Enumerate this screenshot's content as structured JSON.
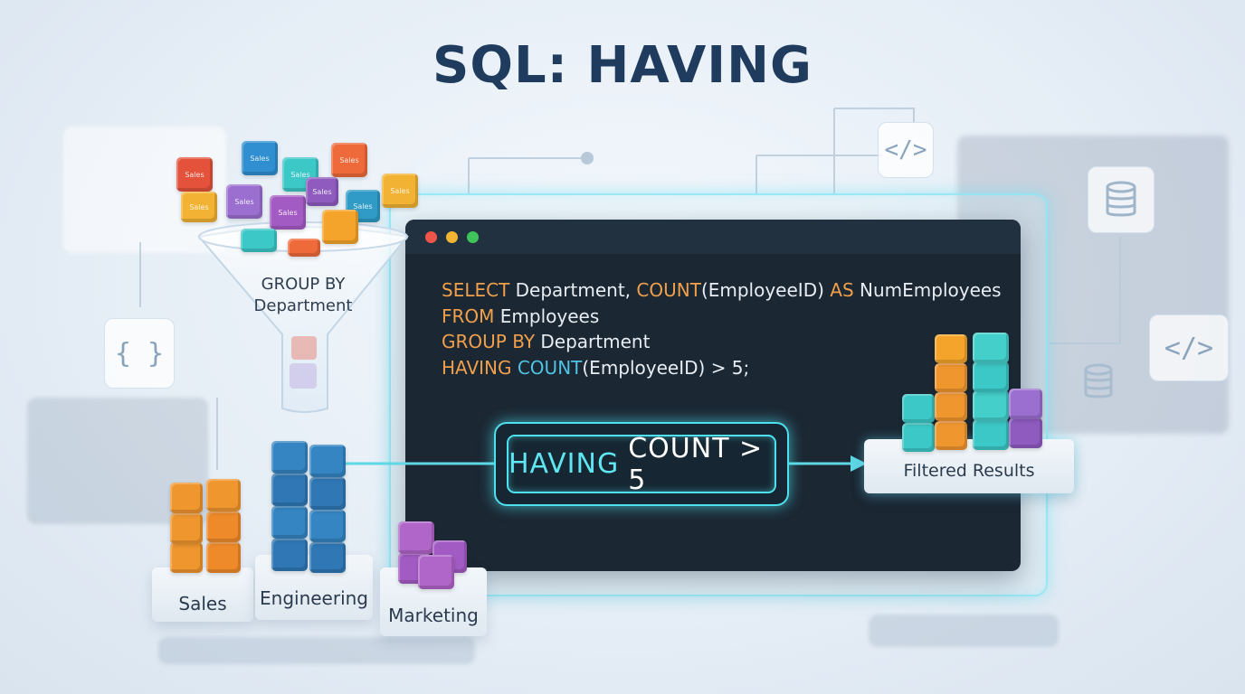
{
  "title": "SQL: HAVING",
  "colors": {
    "sales_orange": "#f0962f",
    "engineering_blue": "#2f78b5",
    "marketing_purple": "#a35bc4",
    "teal": "#3cc8c6",
    "red": "#e4523c",
    "yellow": "#f2b233",
    "keyword": "#f0a04b",
    "function": "#4fc3e3",
    "glow": "#4fe0ee",
    "title": "#1f3b5e"
  },
  "icons": {
    "code_tag": "code-tag-icon",
    "database": "database-icon",
    "braces": "curly-braces-icon"
  },
  "code_chips": {
    "tag": "</>",
    "braces": "{ }"
  },
  "funnel": {
    "label_line1": "GROUP BY",
    "label_line2": "Department",
    "cube_labels": [
      "Sales",
      "Sales",
      "Sales",
      "Sales",
      "Sales",
      "Sales",
      "Sales",
      "Sales",
      "Sales",
      "Sales"
    ]
  },
  "window": {
    "code_lines": [
      [
        {
          "t": "SELECT",
          "c": "kw"
        },
        {
          "t": " Department, ",
          "c": ""
        },
        {
          "t": "COUNT",
          "c": "kw"
        },
        {
          "t": "(EmployeeID) ",
          "c": ""
        },
        {
          "t": "AS",
          "c": "kw"
        },
        {
          "t": " NumEmployees",
          "c": ""
        }
      ],
      [
        {
          "t": "FROM",
          "c": "kw"
        },
        {
          "t": " Employees",
          "c": ""
        }
      ],
      [
        {
          "t": "GROUP BY",
          "c": "kw"
        },
        {
          "t": " Department",
          "c": ""
        }
      ],
      [
        {
          "t": "HAVING",
          "c": "kw"
        },
        {
          "t": " ",
          "c": ""
        },
        {
          "t": "COUNT",
          "c": "fn"
        },
        {
          "t": "(EmployeeID) > 5;",
          "c": ""
        }
      ]
    ]
  },
  "filter": {
    "keyword": "HAVING",
    "condition": "COUNT > 5"
  },
  "groups": {
    "sales": "Sales",
    "engineering": "Engineering",
    "marketing": "Marketing"
  },
  "results": {
    "label": "Filtered Results"
  }
}
